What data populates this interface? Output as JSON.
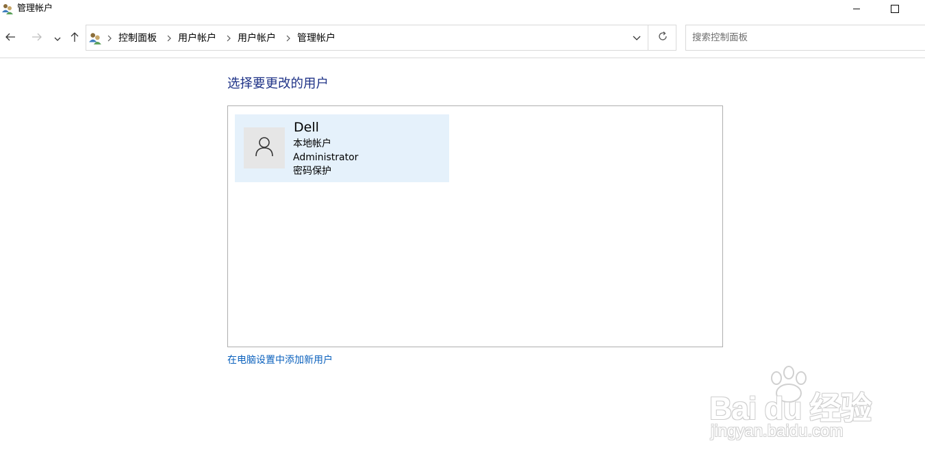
{
  "window": {
    "title": "管理帐户",
    "icon": "users-icon",
    "controls": [
      "minimize-icon",
      "maximize-icon"
    ]
  },
  "navigation": {
    "back": "arrow-left-icon",
    "forward": "arrow-right-icon",
    "recent": "chevron-down-icon",
    "up": "arrow-up-icon"
  },
  "address_bar": {
    "icon": "users-icon",
    "breadcrumbs": [
      "控制面板",
      "用户帐户",
      "用户帐户",
      "管理帐户"
    ],
    "dropdown": "chevron-down-icon",
    "refresh": "refresh-icon"
  },
  "search": {
    "placeholder": "搜索控制面板"
  },
  "main": {
    "heading": "选择要更改的用户",
    "users": [
      {
        "name": "Dell",
        "details": [
          "本地帐户",
          "Administrator",
          "密码保护"
        ],
        "avatar": "user-icon",
        "highlight_color": "#e5f1fb"
      }
    ],
    "add_user_link": "在电脑设置中添加新用户"
  },
  "colors": {
    "heading": "#1e3287",
    "link": "#0b61bd",
    "tile_highlight": "#e5f1fb"
  },
  "watermark": {
    "logo_text": "Bai du 经验",
    "url": "jingyan.baidu.com"
  }
}
